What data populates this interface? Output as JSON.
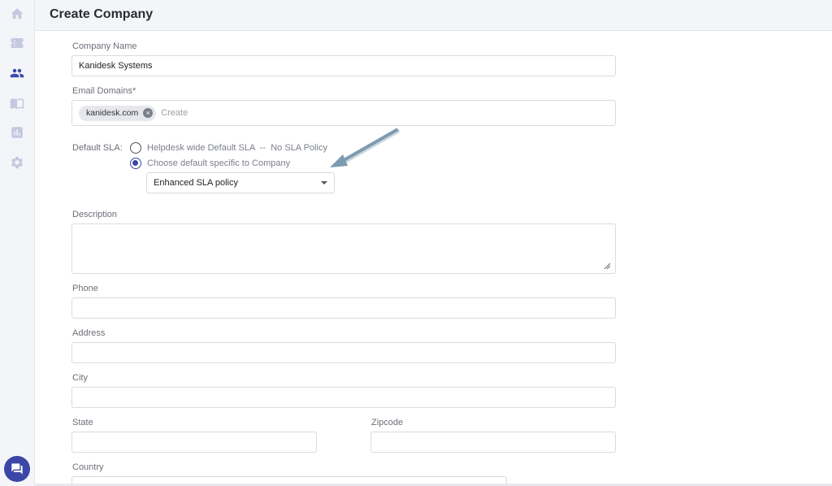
{
  "header": {
    "title": "Create Company"
  },
  "sidebar": {
    "items": [
      {
        "name": "home",
        "icon": "home-icon"
      },
      {
        "name": "tickets",
        "icon": "ticket-icon"
      },
      {
        "name": "customers",
        "icon": "people-icon",
        "active": true
      },
      {
        "name": "knowledge-base",
        "icon": "book-icon"
      },
      {
        "name": "reports",
        "icon": "chart-icon"
      },
      {
        "name": "settings",
        "icon": "gear-icon"
      }
    ],
    "chat_icon": "chat-icon"
  },
  "form": {
    "company_name": {
      "label": "Company Name",
      "value": "Kanidesk Systems"
    },
    "email_domains": {
      "label": "Email Domains*",
      "chips": [
        "kanidesk.com"
      ],
      "placeholder": "Create"
    },
    "default_sla": {
      "label": "Default SLA:",
      "options": [
        {
          "label": "Helpdesk wide Default SLA  --  No SLA Policy",
          "checked": false
        },
        {
          "label": "Choose default specific to Company",
          "checked": true
        }
      ],
      "selected_policy": "Enhanced SLA policy"
    },
    "description": {
      "label": "Description",
      "value": ""
    },
    "phone": {
      "label": "Phone",
      "value": ""
    },
    "address": {
      "label": "Address",
      "value": ""
    },
    "city": {
      "label": "City",
      "value": ""
    },
    "state": {
      "label": "State",
      "value": ""
    },
    "zipcode": {
      "label": "Zipcode",
      "value": ""
    },
    "country": {
      "label": "Country",
      "value": ""
    }
  },
  "colors": {
    "accent": "#3b46a6",
    "arrow": "#7d9bb0",
    "sidebar_bg": "#f4f5f9"
  }
}
